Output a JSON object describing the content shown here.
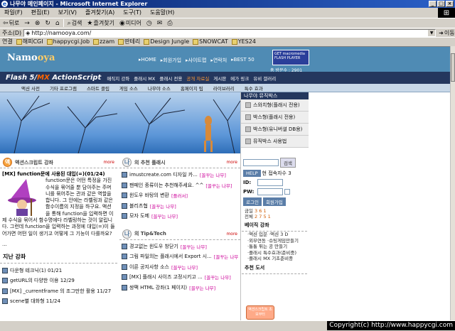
{
  "window": {
    "title": "나무야 메인페이지 - Microsoft Internet Explorer"
  },
  "menu": [
    "파일(F)",
    "편집(E)",
    "보기(V)",
    "즐겨찾기(A)",
    "도구(T)",
    "도움말(H)"
  ],
  "toolbar": {
    "back": "뒤로",
    "forward": "→",
    "search": "검색",
    "favorites": "즐겨찾기",
    "media": "미디어"
  },
  "address": {
    "label": "주소(D)",
    "url": "http://namooya.com/",
    "go": "이동"
  },
  "links": {
    "label": "연결",
    "items": [
      "해피CGI",
      "happycgi.Job",
      "zzam",
      "딴테리",
      "Design Jungle",
      "SNOWCAT",
      "YES24"
    ]
  },
  "site": {
    "logo_a": "Namo",
    "logo_b": "oya",
    "topnav": [
      "▸HOME",
      "▸회원가입",
      "▸사이트맵",
      "▸연락처",
      "▸BEST 50"
    ],
    "flash_badge": "GET macromedia FLASH PLAYER",
    "visit": "총 방문수 : 2901",
    "title_a": "Flash 5/",
    "title_b": "MX",
    "title_c": " ActionScript",
    "nav2": [
      "매직지 강좌",
      "플래시 MX",
      "플래시 전용",
      "공개 자료실",
      "게시판",
      "메가 링크",
      "유비 갤러리"
    ],
    "nav2_hi_index": 3,
    "nav3": [
      "액션 사전",
      "기타 프로그램",
      "스마트 클립",
      "게임 소스",
      "나무야 소스",
      "홈페이지 팁",
      "라이브러리",
      "특수 효과"
    ]
  },
  "rightcol": {
    "head": "나무야 뮤직박스",
    "items": [
      "스와치형(플래시 전용)",
      "박스형(플래시 전용)",
      "박스형(유니버셜 DB용)",
      "뮤직박스 사용법"
    ]
  },
  "left": {
    "section": "액션스크립트 강좌",
    "more": "more",
    "article_title": "[MX] function문에 사용된 대입(=)(01/24)",
    "article_body": "function문은 어떤 특정을 가진 수식을 묶어줄 뿐 담아주는 주머니를 묶어주는 관과 같은 역할을 합니다. 그 안에는 라벨링과 같은 함수이름의 지정을 하구요. 액션을 통해 function을 입력하면 이제 수식을 묶어서 함수명에다 라벨링하는 것이 알립니다. 그런데 function을 입력하는 과정에 대입(=)이 들어가면 어떤 일이 생기고 어떻게 그 기능이 다를까요?",
    "ellipsis": "...",
    "recent_title": "지난 강좌",
    "recent": [
      "다운형 테크닉(1) 01/21",
      "getURL의 다양한 이용 12/29",
      "[MX] _currentframe 의 조그만한 활용 11/27",
      "scene별 대화형 11/24"
    ]
  },
  "mid": {
    "section1": "의 추천 플래시",
    "more": "more",
    "list1": [
      {
        "text": "imustcreate.com 디자일 카...",
        "by": "[꼴꾸는 나무]"
      },
      {
        "text": "팬페인 종류이는 추천해주세요. ^^",
        "by": "[꼴꾸는 나무]"
      },
      {
        "text": "윈도우 바탕의 변환",
        "by": "[플러서]"
      },
      {
        "text": "블리츠협",
        "by": "[꼴꾸는 나무]"
      },
      {
        "text": "모자 도메",
        "by": "[꼴꾸는 나무]"
      }
    ],
    "section2": "의 Tip&Tech",
    "list2": [
      {
        "text": "경고없는 윈도우 창닫기",
        "by": "[꼴꾸는 나무]"
      },
      {
        "text": "그림 파일의는 플래시에서 Export 시...",
        "by": "[꼴꾸는 나무]"
      },
      {
        "text": "이른 공지사항 소스",
        "by": "[꼴꾸는 나무]"
      },
      {
        "text": "[MX] 플래시 사이즈 고정시키고 ...",
        "by": "[꼴꾸는 나무]"
      },
      {
        "text": "쌍팩 HTML 강좌(1 페이지)",
        "by": "[꼴꾸는 나무]"
      }
    ]
  },
  "login": {
    "search_btn": "검색",
    "help": "HELP",
    "users": "현 접속자수 3",
    "id": "ID:",
    "pw": "PW:",
    "login_btn": "로그인",
    "join_btn": "회원가입",
    "stat1_label": "금일",
    "stat1_val": "3 6 1",
    "stat2_label": "전체",
    "stat2_val": "2 7 5 1",
    "section": "베이직 강좌",
    "subs": [
      "·액션 입문 ·액션 3 D",
      "·외부연동 ·슈팅게임만들기",
      "·통통 튀는 공 만들기",
      "·플래시 특수효과(준비중)",
      "·플래시 MX 기초준비중"
    ],
    "new_label": "추천 도서",
    "new_box": "액션스크립트 초보부터"
  },
  "status": {
    "copyright": "Copyright(c) http://www.happycgi.com"
  }
}
